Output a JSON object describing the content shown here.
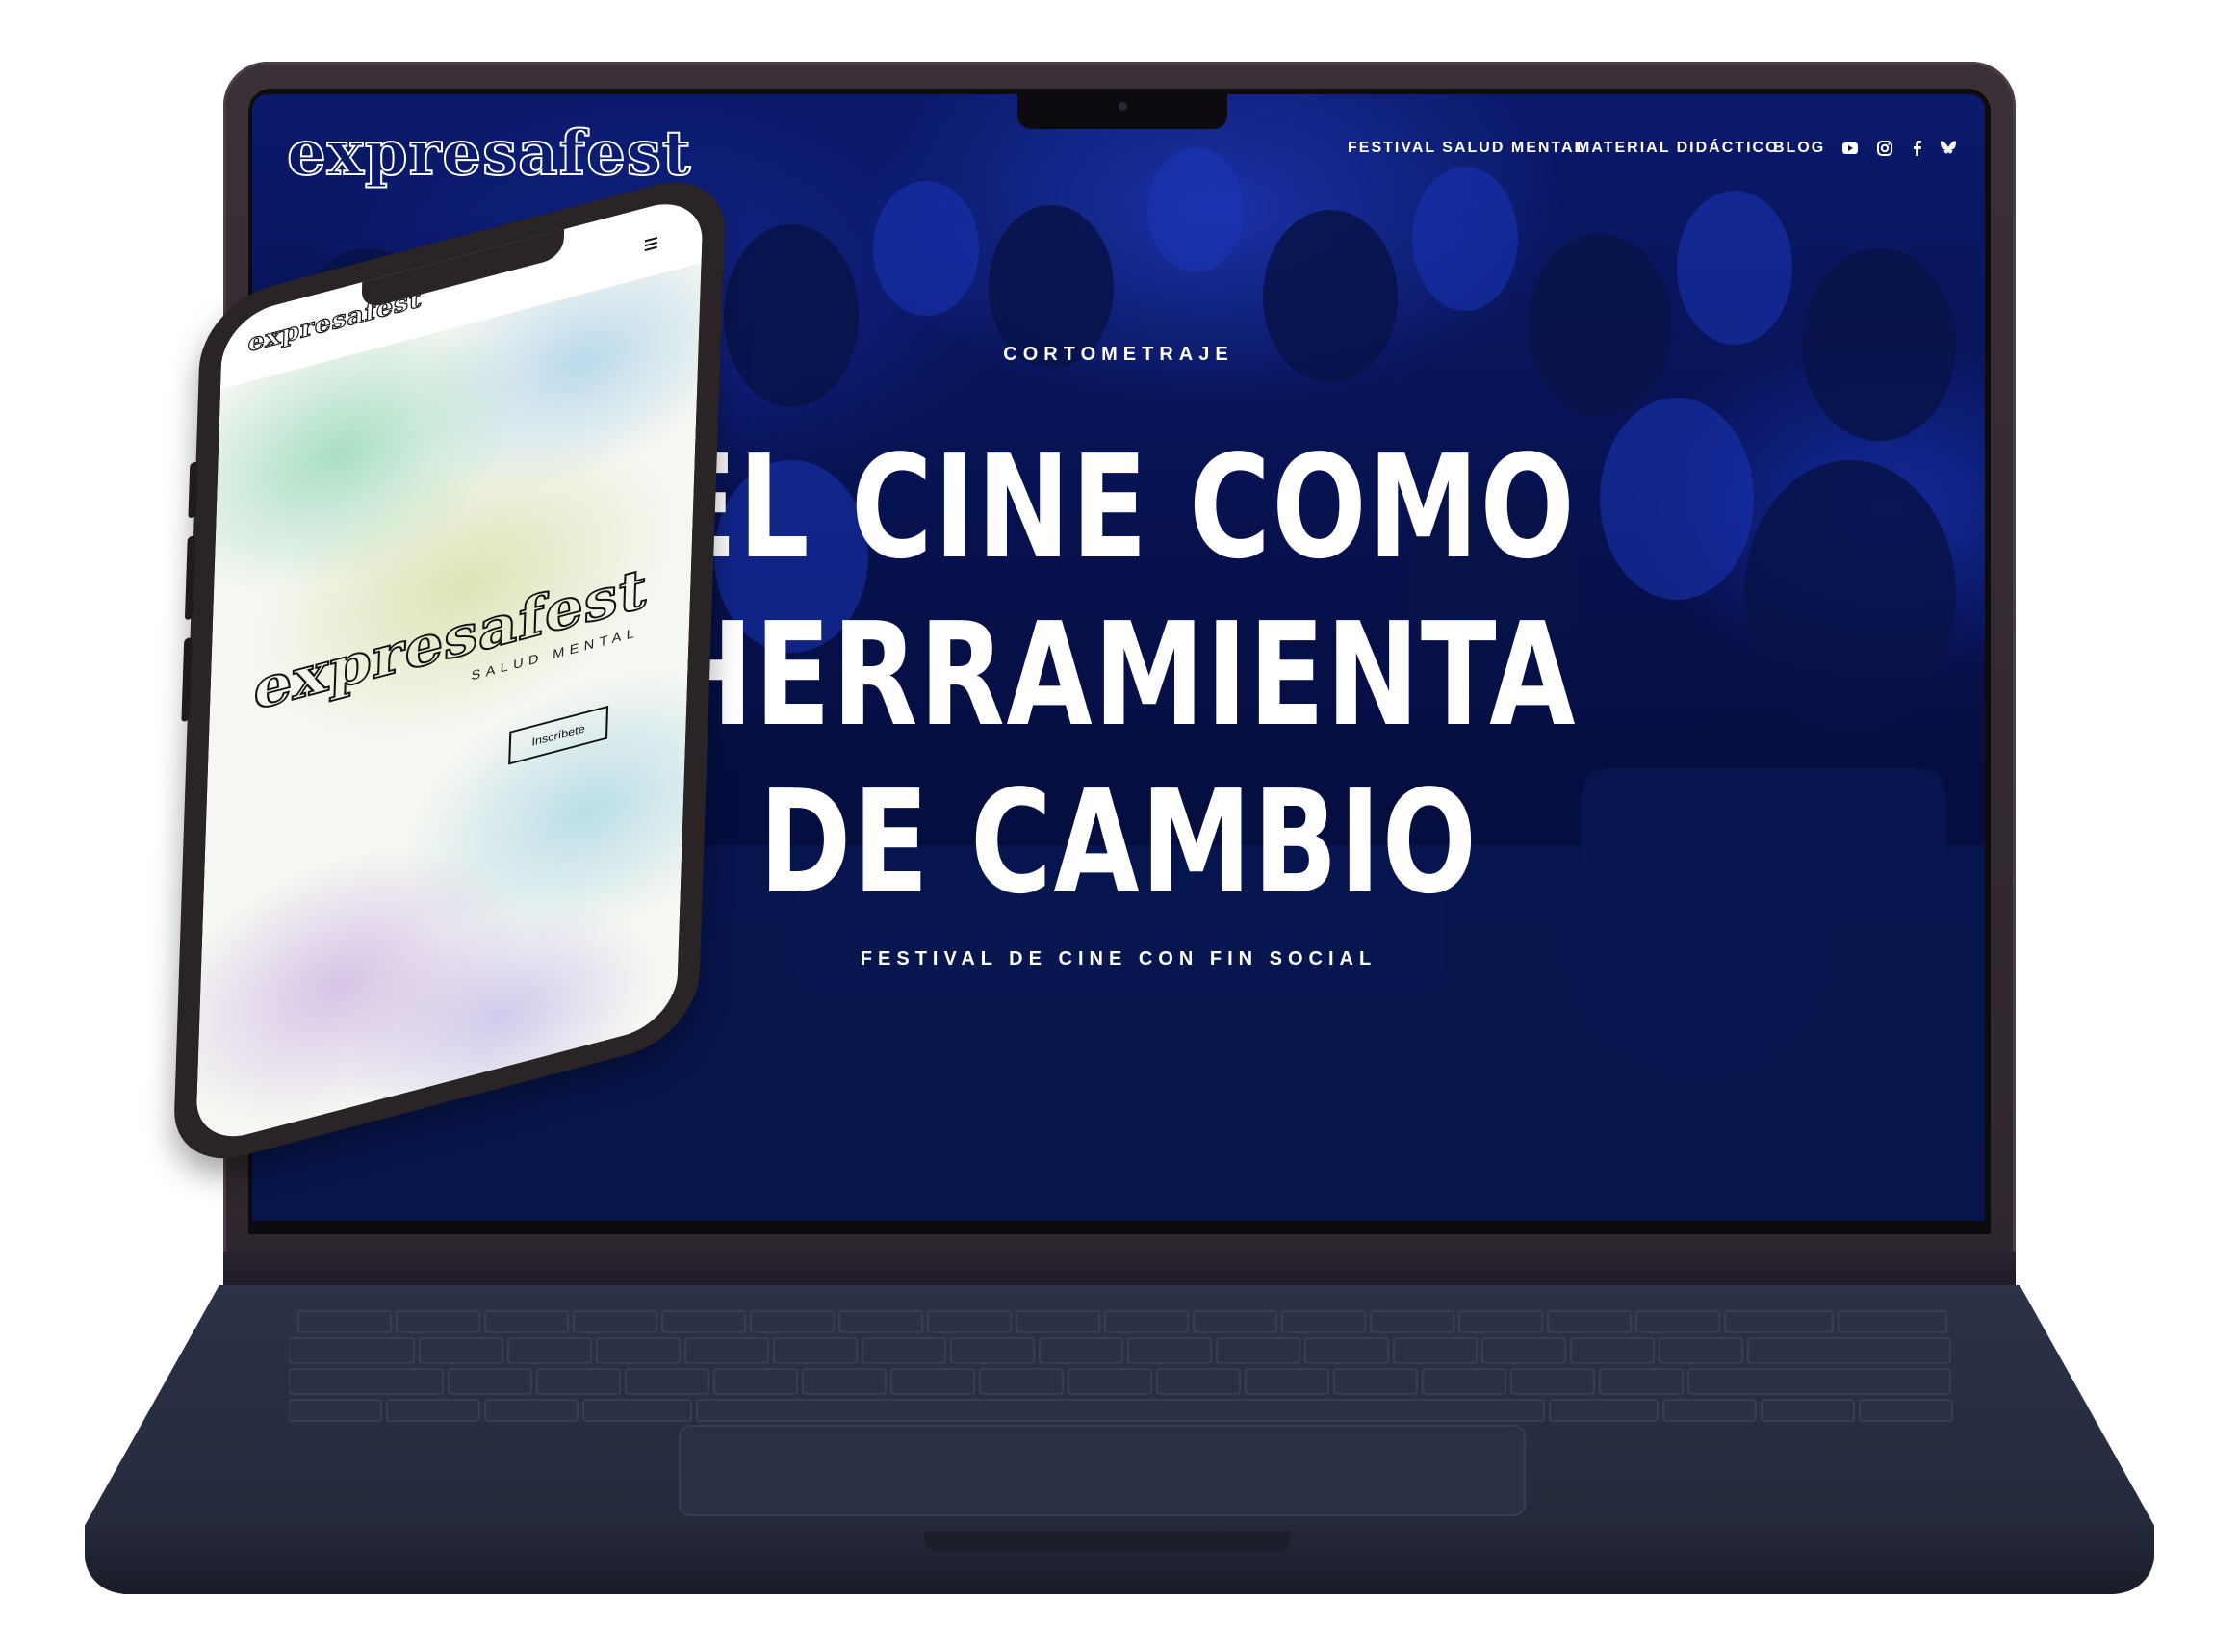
{
  "site": {
    "logo_text": "expresafest",
    "nav": [
      {
        "label": "FESTIVAL SALUD MENTAL"
      },
      {
        "label": "MATERIAL DIDÁCTICO"
      },
      {
        "label": "BLOG"
      }
    ],
    "social_icons": [
      "youtube-icon",
      "instagram-icon",
      "facebook-icon",
      "bluesky-icon"
    ]
  },
  "hero": {
    "eyebrow": "CORTOMETRAJE",
    "title_lines": [
      "EL CINE COMO",
      "HERRAMIENTA",
      "DE CAMBIO"
    ],
    "subtitle": "FESTIVAL DE CINE CON FIN SOCIAL"
  },
  "phone": {
    "logo_small": "expresafest",
    "menu_icon": "menu-icon",
    "logo_big": "expresafest",
    "tagline": "SALUD MENTAL",
    "button_label": "Inscríbete"
  },
  "colors": {
    "hero_bg": "#06104a",
    "accent_blue": "#1a34b8",
    "laptop_body": "#2c3247",
    "phone_body": "#2b2427",
    "text": "#ffffff"
  }
}
